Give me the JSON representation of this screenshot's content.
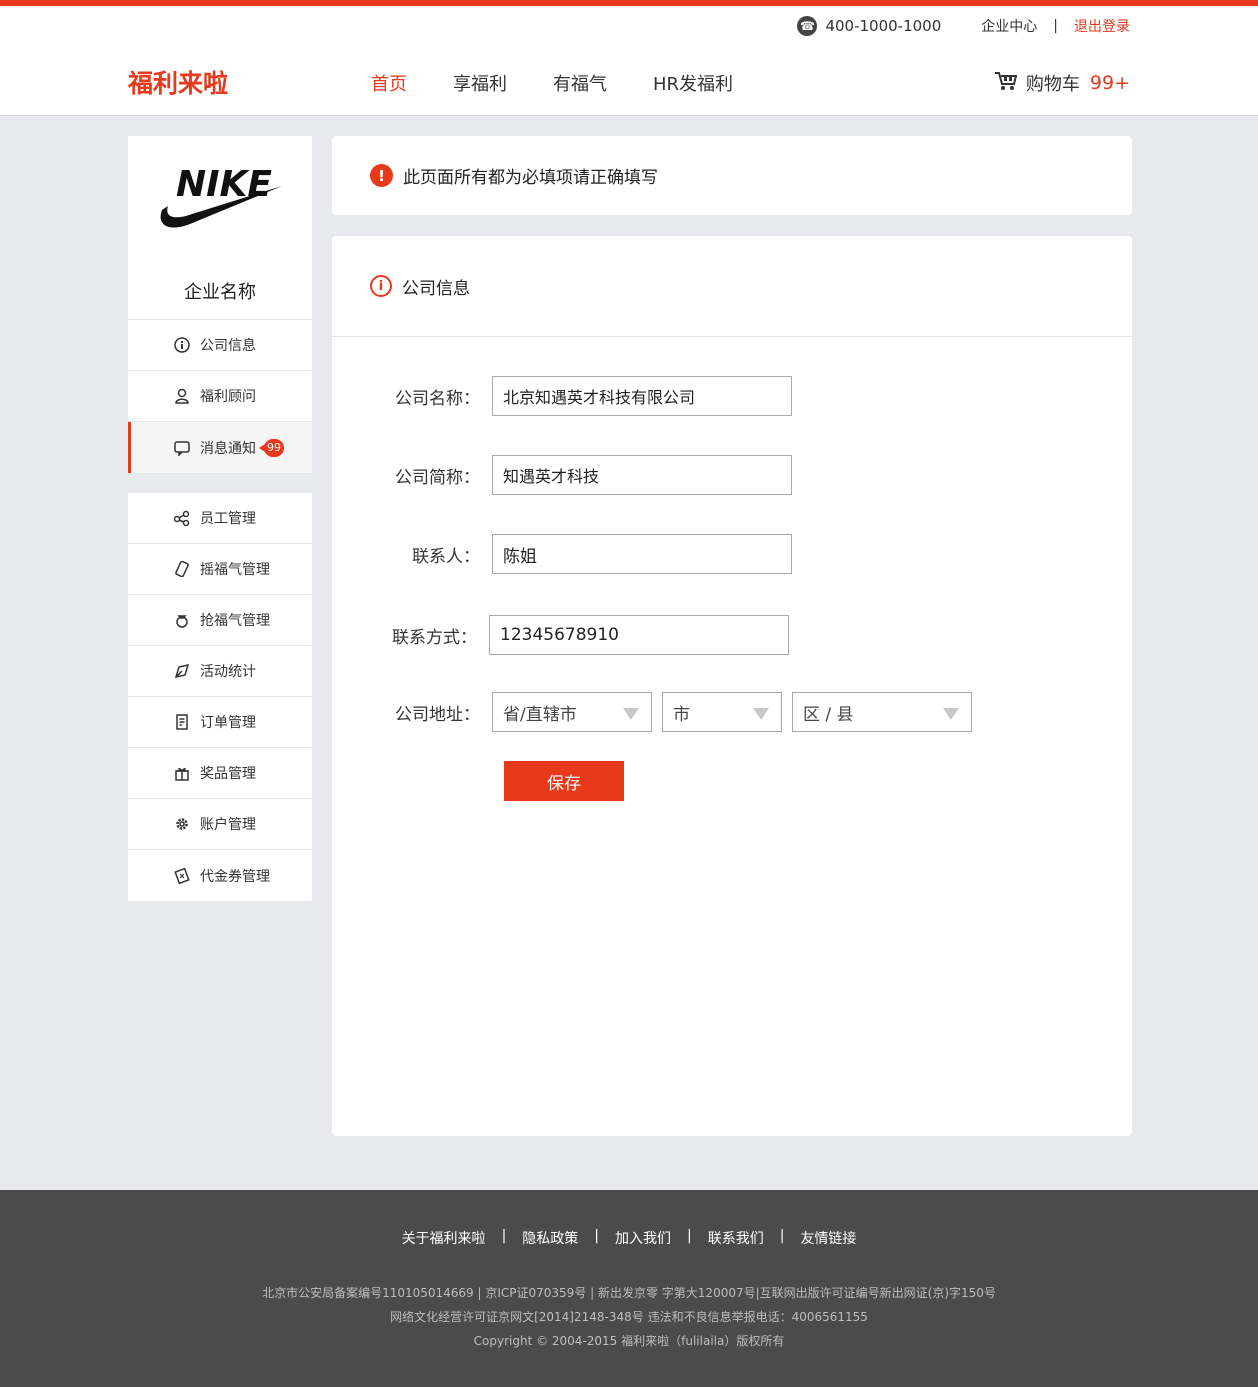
{
  "header": {
    "phone": "400-1000-1000",
    "enterprise_center": "企业中心",
    "separator": "|",
    "logout": "退出登录",
    "logo": "福利来啦",
    "nav": [
      {
        "label": "首页",
        "active": true
      },
      {
        "label": "享福利"
      },
      {
        "label": "有福气"
      },
      {
        "label": "HR发福利"
      }
    ],
    "cart_label": "购物车",
    "cart_count": "99+"
  },
  "sidebar": {
    "brand_name": "企业名称",
    "brand_logo_text": "NIKE",
    "group1": [
      {
        "label": "公司信息",
        "icon": "info-icon"
      },
      {
        "label": "福利顾问",
        "icon": "user-icon"
      },
      {
        "label": "消息通知",
        "icon": "message-icon",
        "badge": "99",
        "active": true
      }
    ],
    "group2": [
      {
        "label": "员工管理",
        "icon": "share-icon"
      },
      {
        "label": "摇福气管理",
        "icon": "shake-icon"
      },
      {
        "label": "抢福气管理",
        "icon": "bag-icon"
      },
      {
        "label": "活动统计",
        "icon": "pen-icon"
      },
      {
        "label": "订单管理",
        "icon": "document-icon"
      },
      {
        "label": "奖品管理",
        "icon": "gift-icon"
      },
      {
        "label": "账户管理",
        "icon": "gear-icon"
      },
      {
        "label": "代金券管理",
        "icon": "coupon-icon"
      }
    ]
  },
  "notice": {
    "text": "此页面所有都为必填项请正确填写"
  },
  "panel": {
    "title": "公司信息",
    "fields": {
      "company_name_label": "公司名称：",
      "company_name_value": "北京知遇英才科技有限公司",
      "short_name_label": "公司简称：",
      "short_name_value": "知遇英才科技",
      "contact_label": "联系人：",
      "contact_value": "陈姐",
      "phone_label": "联系方式：",
      "phone_value": "12345678910",
      "address_label": "公司地址："
    },
    "selects": {
      "province": "省/直辖市",
      "city": "市",
      "district": "区 / 县"
    },
    "save_label": "保存"
  },
  "footer": {
    "links": [
      "关于福利来啦",
      "隐私政策",
      "加入我们",
      "联系我们",
      "友情链接"
    ],
    "separator": "|",
    "legal1": "北京市公安局备案编号110105014669  |  京ICP证070359号  |  新出发京零 字第大120007号|互联网出版许可证编号新出网证(京)字150号",
    "legal2": "网络文化经营许可证京网文[2014]2148-348号  违法和不良信息举报电话：4006561155",
    "legal3": "Copyright © 2004-2015  福利来啦（fulilaila）版权所有"
  },
  "colors": {
    "accent": "#e8391b",
    "footer_bg": "#4b4b4b",
    "page_bg": "#e8e9ed"
  }
}
